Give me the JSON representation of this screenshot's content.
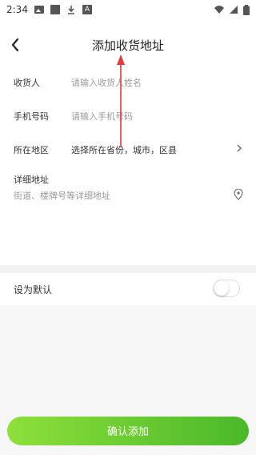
{
  "status_bar": {
    "time": "2:34",
    "icons": [
      "image-icon",
      "square-icon",
      "download-icon",
      "a-icon",
      "wifi-icon",
      "signal-icon",
      "battery-icon"
    ]
  },
  "header": {
    "title": "添加收货地址",
    "back_icon": "chevron-left-icon"
  },
  "form": {
    "recipient": {
      "label": "收货人",
      "placeholder": "请输入收货人姓名"
    },
    "phone": {
      "label": "手机号码",
      "placeholder": "请输入手机号码"
    },
    "region": {
      "label": "所在地区",
      "value": "选择所在省份，城市，区县"
    },
    "detail": {
      "label": "详细地址",
      "placeholder": "街道、楼牌号等详细地址"
    }
  },
  "default_setting": {
    "label": "设为默认",
    "enabled": false
  },
  "confirm_button": {
    "label": "确认添加"
  },
  "colors": {
    "accent_start": "#8ee03a",
    "accent_end": "#4ab82a",
    "placeholder": "#9a9a9a",
    "annotation": "#e03c3c"
  }
}
